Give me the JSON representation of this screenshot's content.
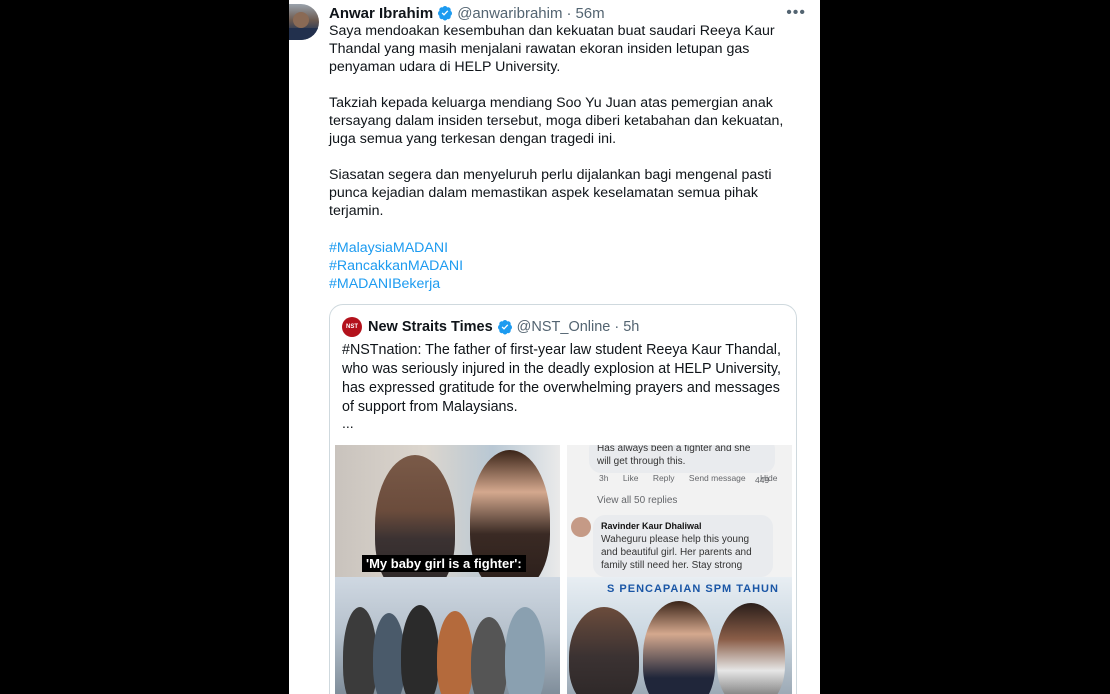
{
  "tweet": {
    "author_name": "Anwar Ibrahim",
    "author_handle": "@anwaribrahim",
    "separator": "·",
    "time": "56m",
    "more": "•••",
    "paragraphs": [
      "Saya mendoakan kesembuhan dan kekuatan buat saudari Reeya Kaur Thandal yang masih menjalani rawatan ekoran insiden letupan gas penyaman udara di HELP University.",
      "Takziah kepada keluarga mendiang Soo Yu Juan atas pemergian anak tersayang dalam insiden tersebut, moga diberi ketabahan dan kekuatan, juga semua yang terkesan dengan tragedi ini.",
      "Siasatan segera dan menyeluruh perlu dijalankan bagi mengenal pasti punca kejadian dalam memastikan aspek keselamatan semua pihak terjamin."
    ],
    "hashtags": [
      "#MalaysiaMADANI",
      "#RancakkanMADANI",
      "#MADANIBekerja"
    ]
  },
  "quoted": {
    "author_name": "New Straits Times",
    "author_handle": "@NST_Online",
    "separator": "·",
    "time": "5h",
    "logo_text": "New Straits Times",
    "text": "#NSTnation: The father of first-year law student Reeya Kaur Thandal, who was seriously injured in the deadly explosion at HELP University, has expressed gratitude for the overwhelming prayers and messages of support from Malaysians.",
    "ellipsis": "...",
    "image1_caption": "'My baby girl is a fighter':",
    "image2": {
      "comment1": "Has always been a fighter and she will get through this.",
      "actions": [
        "3h",
        "Like",
        "Reply",
        "Send message",
        "Hide"
      ],
      "likes": "449",
      "replies": "View all 50 replies",
      "commenter2": "Ravinder Kaur Dhaliwal",
      "comment2": "Waheguru please help this young and beautiful girl. Her parents and family still need her. Stay strong"
    },
    "image4_banner": "S PENCAPAIAN SPM TAHUN"
  },
  "colors": {
    "link": "#1d9bf0",
    "verified": "#1d9bf0",
    "muted": "#536471",
    "border": "#cfd9de"
  }
}
